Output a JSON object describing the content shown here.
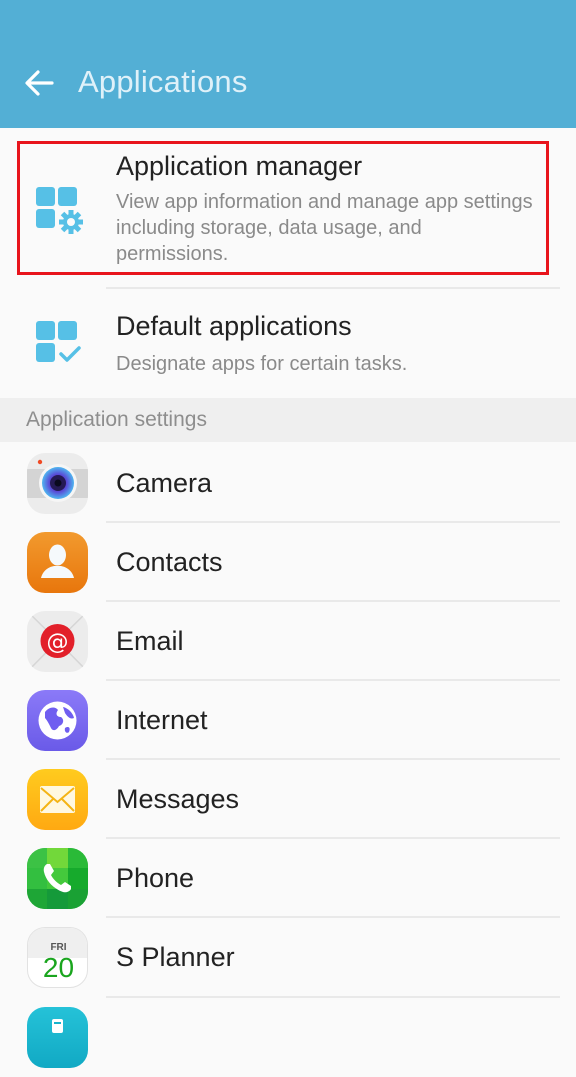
{
  "appbar": {
    "title": "Applications",
    "back_icon": "arrow-left-icon",
    "color": "#53afd5"
  },
  "top_items": [
    {
      "title": "Application manager",
      "subtitle": "View app information and manage app settings including storage, data usage, and permissions.",
      "icon": "grid-gear-icon",
      "highlighted": true
    },
    {
      "title": "Default applications",
      "subtitle": "Designate apps for certain tasks.",
      "icon": "grid-check-icon",
      "highlighted": false
    }
  ],
  "section": {
    "title": "Application settings"
  },
  "apps": [
    {
      "label": "Camera",
      "icon": "camera-icon"
    },
    {
      "label": "Contacts",
      "icon": "contacts-icon"
    },
    {
      "label": "Email",
      "icon": "email-icon"
    },
    {
      "label": "Internet",
      "icon": "internet-icon"
    },
    {
      "label": "Messages",
      "icon": "messages-icon"
    },
    {
      "label": "Phone",
      "icon": "phone-icon"
    },
    {
      "label": "S Planner",
      "icon": "calendar-icon",
      "calendar_day": "FRI",
      "calendar_date": "20"
    }
  ],
  "colors": {
    "highlight_border": "#e8141c",
    "icon_blue": "#56c0e6"
  }
}
